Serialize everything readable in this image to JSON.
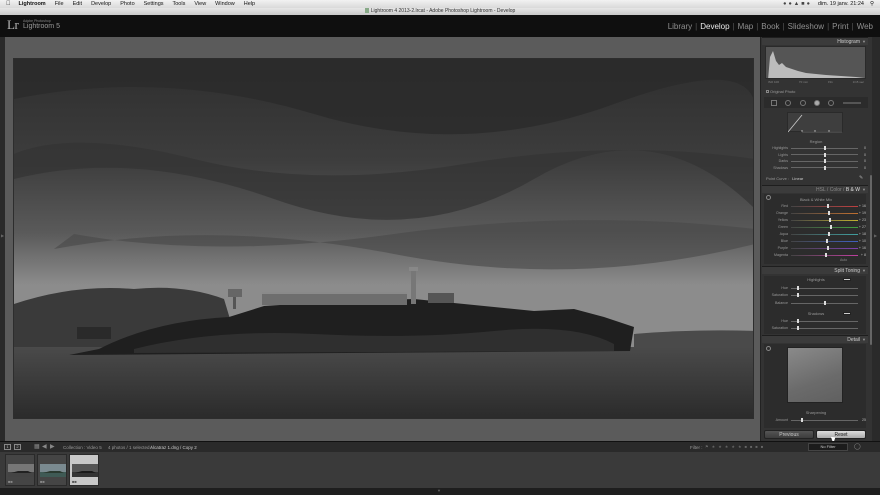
{
  "menubar": {
    "items": [
      "Lightroom",
      "File",
      "Edit",
      "Develop",
      "Photo",
      "Settings",
      "Tools",
      "View",
      "Window",
      "Help"
    ],
    "clock": "dim. 19 janv. 21:24"
  },
  "window": {
    "title": "Lightroom 4 2013-2.lrcat - Adobe Photoshop Lightroom - Develop"
  },
  "identity": {
    "logo": "Lr",
    "product_small": "Adobe Photoshop",
    "product": "Lightroom 5"
  },
  "modules": [
    {
      "label": "Library",
      "active": false
    },
    {
      "label": "Develop",
      "active": true
    },
    {
      "label": "Map",
      "active": false
    },
    {
      "label": "Book",
      "active": false
    },
    {
      "label": "Slideshow",
      "active": false
    },
    {
      "label": "Print",
      "active": false
    },
    {
      "label": "Web",
      "active": false
    }
  ],
  "histogram": {
    "title": "Histogram",
    "info": [
      "ISO 100",
      "70 mm",
      "f/11",
      "1/15 sec"
    ],
    "original_photo": "Original Photo"
  },
  "tone_curve": {
    "region_label": "Region",
    "sliders": [
      {
        "label": "Highlights",
        "value": "0",
        "pos": 0.5
      },
      {
        "label": "Lights",
        "value": "0",
        "pos": 0.5
      },
      {
        "label": "Darks",
        "value": "0",
        "pos": 0.5
      },
      {
        "label": "Shadows",
        "value": "0",
        "pos": 0.5
      }
    ],
    "point_curve_label": "Point Curve :",
    "point_curve_value": "Linear"
  },
  "hsl": {
    "tabs": [
      "HSL",
      "Color",
      "B & W"
    ],
    "bw_title": "Black & White Mix",
    "sliders": [
      {
        "label": "Red",
        "value": "+ 16",
        "pos": 0.55,
        "color": "#c04040"
      },
      {
        "label": "Orange",
        "value": "+ 19",
        "pos": 0.57,
        "color": "#c07030"
      },
      {
        "label": "Yellow",
        "value": "+ 23",
        "pos": 0.58,
        "color": "#c0b030"
      },
      {
        "label": "Green",
        "value": "+ 27",
        "pos": 0.6,
        "color": "#40a040"
      },
      {
        "label": "Aqua",
        "value": "+ 18",
        "pos": 0.56,
        "color": "#40a0a0"
      },
      {
        "label": "Blue",
        "value": "+ 10",
        "pos": 0.53,
        "color": "#4060c0"
      },
      {
        "label": "Purple",
        "value": "+ 16",
        "pos": 0.55,
        "color": "#8040b0"
      },
      {
        "label": "Magenta",
        "value": "+ 8",
        "pos": 0.52,
        "color": "#c040a0"
      }
    ],
    "auto_label": "Auto"
  },
  "split_toning": {
    "title": "Split Toning",
    "highlights_label": "Highlights",
    "shadows_label": "Shadows",
    "balance_label": "Balance",
    "highlight_sliders": [
      {
        "label": "Hue",
        "value": "",
        "pos": 0.1
      },
      {
        "label": "Saturation",
        "value": "",
        "pos": 0.1
      }
    ],
    "balance": {
      "label": "Balance",
      "value": "",
      "pos": 0.5
    },
    "shadow_sliders": [
      {
        "label": "Hue",
        "value": "",
        "pos": 0.1
      },
      {
        "label": "Saturation",
        "value": "",
        "pos": 0.1
      }
    ]
  },
  "detail": {
    "title": "Detail",
    "sharpening_label": "Sharpening",
    "amount": {
      "label": "Amount",
      "value": "25",
      "pos": 0.17
    }
  },
  "buttons": {
    "previous": "Previous",
    "reset": "Reset"
  },
  "filmbar": {
    "monitor1": "1",
    "monitor2": "2",
    "collection": "Collection : Video 5",
    "selection": "4 photos / 1 selected /",
    "file": "Alcatraz 1.dng / Copy 2",
    "filter_label": "Filter :",
    "filter_value": "No Filter"
  },
  "colors": {
    "accent": "#eaeaea",
    "panel": "#333333",
    "canvas": "#5b5b5b"
  }
}
